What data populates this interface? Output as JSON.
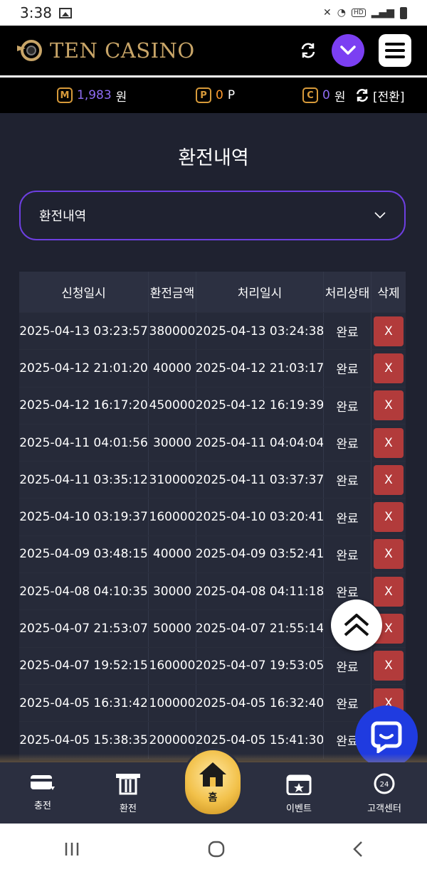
{
  "status_bar": {
    "time": "3:38",
    "hd_label": "HD"
  },
  "header": {
    "brand": "TEN CASINO"
  },
  "wallet": {
    "money_badge": "M",
    "money_value": "1,983",
    "money_unit": "원",
    "point_badge": "P",
    "point_value": "0",
    "point_unit": "P",
    "coin_badge": "C",
    "coin_value": "0",
    "coin_unit": "원",
    "swap_label": "[전환]"
  },
  "page": {
    "title": "환전내역"
  },
  "dropdown": {
    "selected": "환전내역"
  },
  "table": {
    "headers": [
      "신청일시",
      "환전금액",
      "처리일시",
      "처리상태",
      "삭제"
    ],
    "delete_label": "X",
    "rows": [
      [
        "2025-04-13 03:23:57",
        "380000",
        "2025-04-13 03:24:38",
        "완료"
      ],
      [
        "2025-04-12 21:01:20",
        "40000",
        "2025-04-12 21:03:17",
        "완료"
      ],
      [
        "2025-04-12 16:17:20",
        "450000",
        "2025-04-12 16:19:39",
        "완료"
      ],
      [
        "2025-04-11 04:01:56",
        "30000",
        "2025-04-11 04:04:04",
        "완료"
      ],
      [
        "2025-04-11 03:35:12",
        "310000",
        "2025-04-11 03:37:37",
        "완료"
      ],
      [
        "2025-04-10 03:19:37",
        "160000",
        "2025-04-10 03:20:41",
        "완료"
      ],
      [
        "2025-04-09 03:48:15",
        "40000",
        "2025-04-09 03:52:41",
        "완료"
      ],
      [
        "2025-04-08 04:10:35",
        "30000",
        "2025-04-08 04:11:18",
        "완료"
      ],
      [
        "2025-04-07 21:53:07",
        "50000",
        "2025-04-07 21:55:14",
        "완료"
      ],
      [
        "2025-04-07 19:52:15",
        "160000",
        "2025-04-07 19:53:05",
        "완료"
      ],
      [
        "2025-04-05 16:31:42",
        "100000",
        "2025-04-05 16:32:40",
        "완료"
      ],
      [
        "2025-04-05 15:38:35",
        "200000",
        "2025-04-05 15:41:30",
        "완료"
      ]
    ]
  },
  "bottom_nav": {
    "charge": "충전",
    "exchange": "환전",
    "home": "홈",
    "event": "이벤트",
    "support": "고객센터",
    "support_badge": "24"
  },
  "colors": {
    "accent_purple": "#7b3ff2",
    "brand_gold": "#c8a568",
    "delete_red": "#b23b3b",
    "chat_blue": "#1f3be0"
  }
}
